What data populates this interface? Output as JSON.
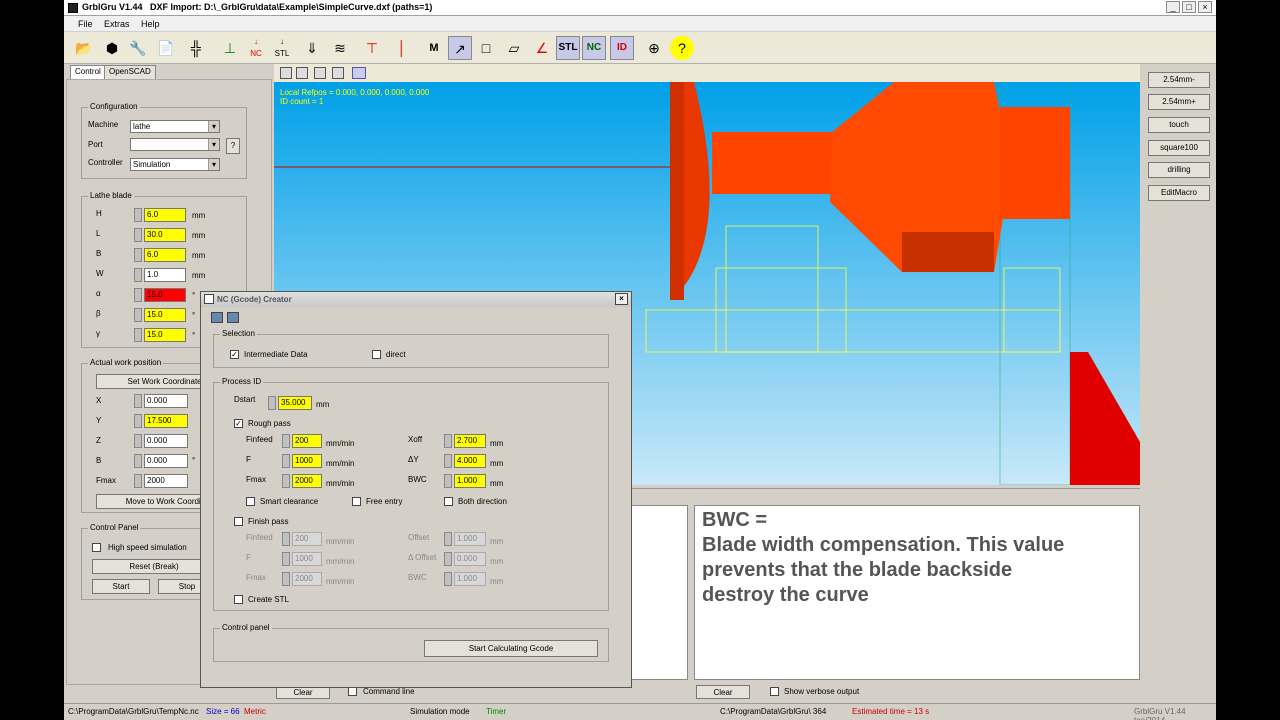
{
  "app": {
    "title": "GrblGru V1.44",
    "file_title": "DXF Import: D:\\_GrblGru\\data\\Example\\SimpleCurve.dxf (paths=1)"
  },
  "menu": [
    "File",
    "Extras",
    "Help"
  ],
  "toolbar": {
    "stl_label": "STL",
    "nc_label": "NC",
    "id_label": "ID",
    "nc_small": "NC",
    "stl_small": "STL",
    "m_label": "M"
  },
  "tabs": [
    "Control",
    "OpenSCAD"
  ],
  "configuration": {
    "title": "Configuration",
    "machine_label": "Machine",
    "machine_value": "lathe",
    "port_label": "Port",
    "port_value": "",
    "controller_label": "Controller",
    "controller_value": "Simulation",
    "help": "?"
  },
  "lathe_blade": {
    "title": "Lathe blade",
    "fields": [
      {
        "label": "H",
        "value": "6.0",
        "unit": "mm"
      },
      {
        "label": "L",
        "value": "30.0",
        "unit": "mm"
      },
      {
        "label": "B",
        "value": "6.0",
        "unit": "mm"
      },
      {
        "label": "W",
        "value": "1.0",
        "unit": "mm"
      },
      {
        "label": "α",
        "value": "15.0",
        "unit": "°"
      },
      {
        "label": "β",
        "value": "15.0",
        "unit": "°"
      },
      {
        "label": "γ",
        "value": "15.0",
        "unit": "°"
      }
    ]
  },
  "work_position": {
    "title": "Actual work position",
    "set_button": "Set Work Coordinate Ori",
    "fields": [
      {
        "label": "X",
        "value": "0.000"
      },
      {
        "label": "Y",
        "value": "17.500"
      },
      {
        "label": "Z",
        "value": "0.000"
      },
      {
        "label": "B",
        "value": "0.000",
        "unit": "°"
      },
      {
        "label": "Fmax",
        "value": "2000"
      }
    ],
    "move_button": "Move to Work Coordinate"
  },
  "control_panel": {
    "title": "Control Panel",
    "high_speed": "High speed simulation",
    "reset": "Reset (Break)",
    "start": "Start",
    "stop": "Stop"
  },
  "viewport": {
    "refpos": "Local Refpos = 0.000, 0.000, 0.000, 0.000",
    "id_count": "ID count = 1"
  },
  "right_buttons": [
    "2.54mm-",
    "2.54mm+",
    "touch",
    "square100",
    "drilling",
    "EditMacro"
  ],
  "dialog": {
    "title": "NC (Gcode) Creator",
    "selection": "Selection",
    "intermediate": "Intermediate Data",
    "direct": "direct",
    "process_id": "Process ID",
    "dstart_label": "Dstart",
    "dstart_value": "35.000",
    "mm": "mm",
    "mm_min": "mm/min",
    "rough_pass": "Rough pass",
    "rough_left": [
      {
        "label": "Finfeed",
        "value": "200"
      },
      {
        "label": "F",
        "value": "1000"
      },
      {
        "label": "Fmax",
        "value": "2000"
      }
    ],
    "rough_right": [
      {
        "label": "Xoff",
        "value": "2.700"
      },
      {
        "label": "ΔY",
        "value": "4.000"
      },
      {
        "label": "BWC",
        "value": "1.000"
      }
    ],
    "smart_clearance": "Smart clearance",
    "free_entry": "Free entry",
    "both_direction": "Both direction",
    "finish_pass": "Finish pass",
    "finish_left": [
      {
        "label": "Finfeed",
        "value": "200"
      },
      {
        "label": "F",
        "value": "1000"
      },
      {
        "label": "Fmax",
        "value": "2000"
      }
    ],
    "finish_right": [
      {
        "label": "Offset",
        "value": "1.000"
      },
      {
        "label": "Δ Offset",
        "value": "0.000"
      },
      {
        "label": "BWC",
        "value": "1.000"
      }
    ],
    "create_stl": "Create STL",
    "control_panel": "Control panel",
    "start_calc": "Start Calculating Gcode"
  },
  "bottom": {
    "clear1": "Clear",
    "command_line": "Command line",
    "clear2": "Clear",
    "verbose": "Show verbose output"
  },
  "annotation": {
    "line1": "BWC =",
    "line2": "Blade width compensation. This value",
    "line3": "prevents that the blade backside",
    "line4": "destroy the curve"
  },
  "status": {
    "path": "C:\\ProgramData\\GrblGru\\TempNc.nc",
    "size": "Size = 66",
    "metric": "Metric",
    "mode": "Simulation mode",
    "timer": "Timer",
    "path2": "C:\\ProgramData\\GrblGru\\ 364",
    "estimated": "Estimated time = 13 s",
    "version": "GrblGru V1.44 toe/2014"
  },
  "colors": {
    "part": "#ff4400",
    "yellow": "#ffff00",
    "sky_top": "#00a0e8"
  }
}
